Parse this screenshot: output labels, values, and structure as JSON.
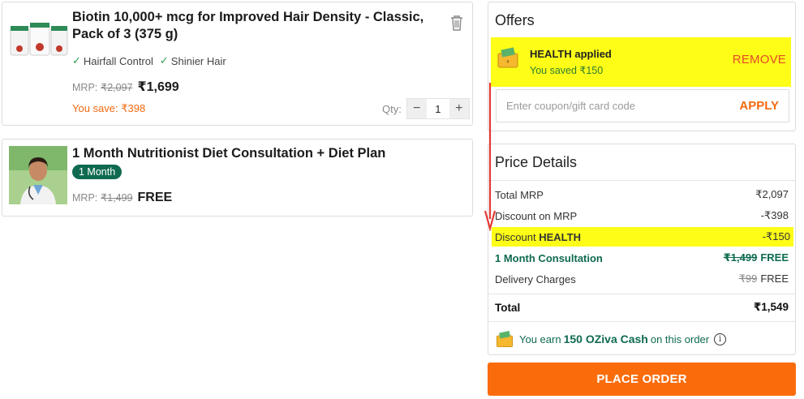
{
  "cart": {
    "items": [
      {
        "title": "Biotin 10,000+ mcg for Improved Hair Density - Classic, Pack of 3 (375 g)",
        "benefits": [
          "Hairfall Control",
          "Shinier Hair"
        ],
        "mrp_label": "MRP:",
        "mrp": "₹2,097",
        "price": "₹1,699",
        "you_save": "You save: ₹398",
        "qty_label": "Qty:",
        "qty": "1",
        "qty_minus": "−",
        "qty_plus": "+"
      },
      {
        "title": "1 Month Nutritionist Diet Consultation + Diet Plan",
        "tag": "1 Month",
        "mrp_label": "MRP:",
        "mrp": "₹1,499",
        "price": "FREE"
      }
    ]
  },
  "offers": {
    "title": "Offers",
    "applied_code": "HEALTH applied",
    "saved_text": "You saved ₹150",
    "remove_label": "REMOVE",
    "coupon_placeholder": "Enter coupon/gift card code",
    "apply_label": "APPLY"
  },
  "price_details": {
    "title": "Price Details",
    "rows": {
      "total_mrp": {
        "label": "Total MRP",
        "value": "₹2,097"
      },
      "discount_mrp": {
        "label": "Discount on MRP",
        "value": "-₹398"
      },
      "discount_code": {
        "label": "Discount ",
        "code": "HEALTH",
        "value": "-₹150"
      },
      "consultation": {
        "label": "1 Month Consultation",
        "strike": "₹1,499",
        "value": "FREE"
      },
      "delivery": {
        "label": "Delivery Charges",
        "strike": "₹99",
        "value": "FREE"
      },
      "total": {
        "label": "Total",
        "value": "₹1,549"
      }
    },
    "earn": {
      "prefix": "You earn",
      "amount": "150 OZiva Cash",
      "suffix": "on this order",
      "info": "i"
    }
  },
  "place_order_label": "PLACE ORDER",
  "colors": {
    "accent_orange": "#fa6c0b",
    "highlight_yellow": "#fdfd17",
    "brand_green": "#0f6a50",
    "annotation_red": "#e53935"
  }
}
